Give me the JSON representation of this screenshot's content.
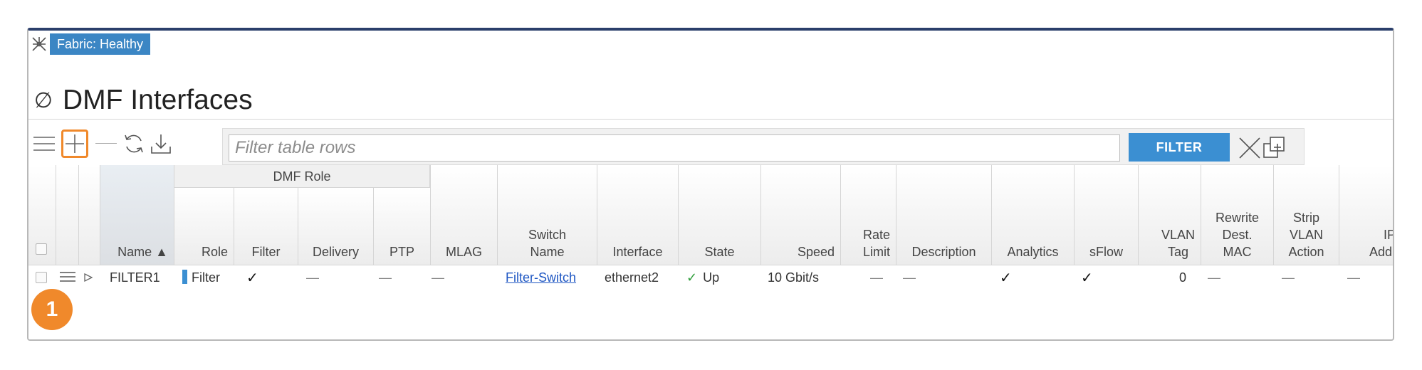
{
  "fabric": {
    "status_label": "Fabric: Healthy",
    "icon": "fabric-icon"
  },
  "page": {
    "title": "DMF Interfaces",
    "title_icon": "∅"
  },
  "toolbar": {
    "menu_icon": "hamburger-menu-icon",
    "add_icon": "plus-icon",
    "refresh_icon": "refresh-icon",
    "download_icon": "download-icon"
  },
  "filter": {
    "placeholder": "Filter table rows",
    "value": "",
    "button_label": "FILTER",
    "clear_icon": "close-icon",
    "expand_icon": "expand-window-icon"
  },
  "table": {
    "group_header": "DMF Role",
    "columns": {
      "name": "Name ▲",
      "role": "Role",
      "filter": "Filter",
      "delivery": "Delivery",
      "ptp": "PTP",
      "mlag": "MLAG",
      "switch_name_1": "Switch",
      "switch_name_2": "Name",
      "interface": "Interface",
      "state": "State",
      "speed": "Speed",
      "rate_limit_1": "Rate",
      "rate_limit_2": "Limit",
      "description": "Description",
      "analytics": "Analytics",
      "sflow": "sFlow",
      "vlan_tag_1": "VLAN",
      "vlan_tag_2": "Tag",
      "rewrite_1": "Rewrite",
      "rewrite_2": "Dest.",
      "rewrite_3": "MAC",
      "strip_1": "Strip",
      "strip_2": "VLAN",
      "strip_3": "Action",
      "ip_1": "IP",
      "ip_2": "Addres"
    },
    "rows": [
      {
        "name": "FILTER1",
        "role": "Filter",
        "filter": "✓",
        "delivery": "—",
        "ptp": "—",
        "mlag": "—",
        "switch_name": "Filter-Switch",
        "interface": "ethernet2",
        "state": "Up",
        "speed": "10 Gbit/s",
        "rate_limit": "—",
        "description": "—",
        "analytics": "✓",
        "sflow": "✓",
        "vlan_tag": "0",
        "rewrite_dest_mac": "—",
        "strip_vlan_action": "—",
        "ip_address": "—"
      }
    ]
  },
  "callout": {
    "number": "1"
  },
  "colors": {
    "accent": "#3b8fd2",
    "highlight": "#f0892b",
    "status_up": "#2e9e3a",
    "header_bar": "#2b3f6b"
  }
}
